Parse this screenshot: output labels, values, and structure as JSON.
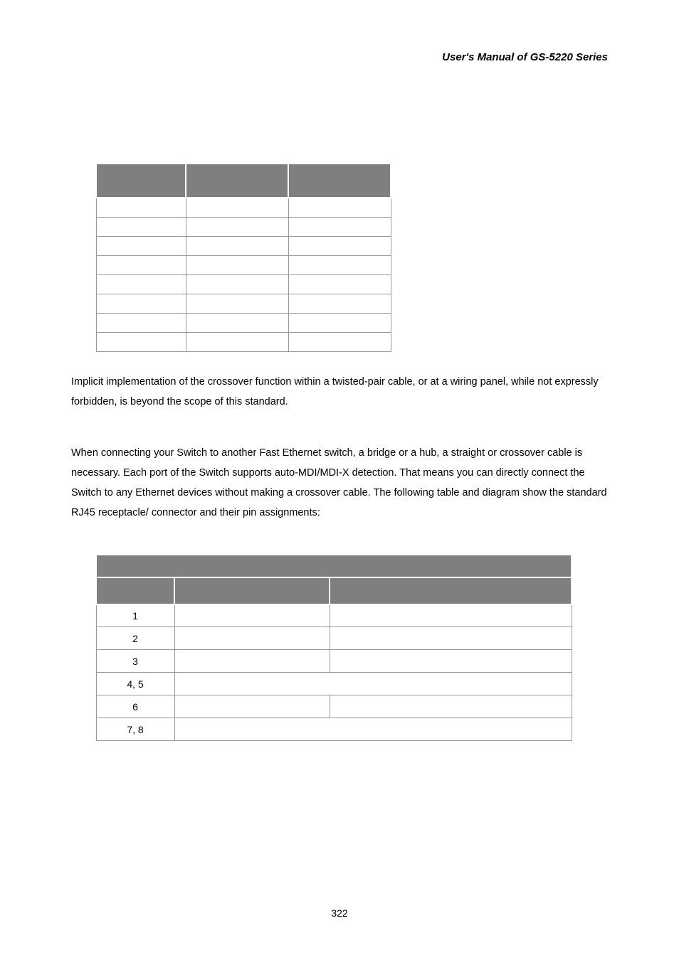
{
  "header": {
    "title": "User's Manual of GS-5220 Series"
  },
  "para1": "Implicit implementation of the crossover function within a twisted-pair cable, or at a wiring panel, while not expressly forbidden, is beyond the scope of this standard.",
  "para2": "When connecting your Switch to another Fast Ethernet switch, a bridge or a hub, a straight or crossover cable is necessary. Each port of the Switch supports auto-MDI/MDI-X detection. That means you can directly connect the Switch to any Ethernet devices without making a crossover cable. The following table and diagram show the standard RJ45 receptacle/ connector and their pin assignments:",
  "table2": {
    "rows": [
      "1",
      "2",
      "3",
      "4, 5",
      "6",
      "7, 8"
    ]
  },
  "pagenum": "322"
}
